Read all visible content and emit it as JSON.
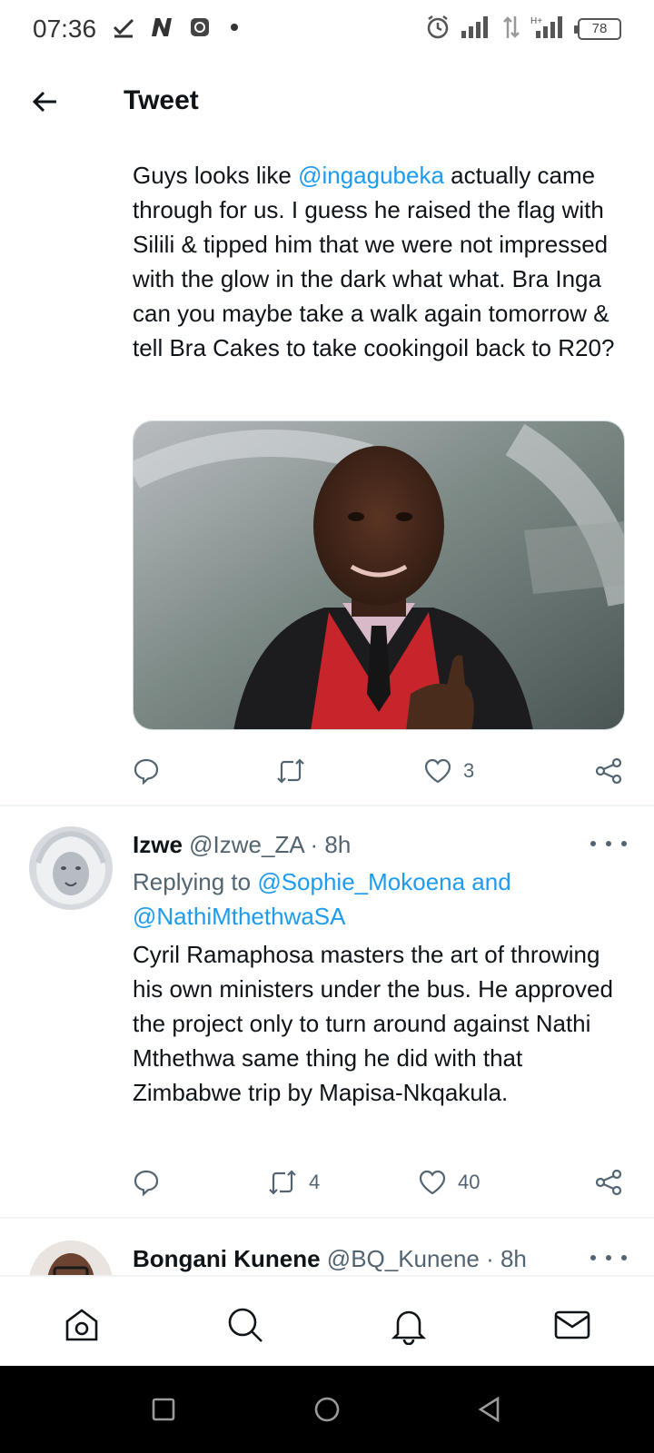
{
  "status_bar": {
    "time": "07:36",
    "battery": "78",
    "network_label": "H+"
  },
  "header": {
    "title": "Tweet"
  },
  "tweet1": {
    "text_before": "Guys looks like ",
    "mention": "@ingagubeka",
    "text_after": " actually came through for us. I guess he raised the flag with Silili & tipped him that we were not impressed with the glow in the dark what what. Bra Inga can you maybe take a walk again tomorrow & tell Bra Cakes to take cookingoil back to R20?",
    "retweets": "",
    "likes": "3"
  },
  "tweet2": {
    "name": "Izwe",
    "handle": "@Izwe_ZA",
    "time": "· 8h",
    "replying_label": "Replying to ",
    "replying_mention": "@Sophie_Mokoena and @NathiMthethwaSA",
    "text": "Cyril Ramaphosa masters the art of throwing his own ministers under the bus. He approved the project only to turn around against Nathi Mthethwa same thing he did with that Zimbabwe trip by Mapisa-Nkqakula.",
    "retweets": "4",
    "likes": "40"
  },
  "tweet3": {
    "name": "Bongani Kunene",
    "handle": "@BQ_Kunene",
    "time": "· 8h"
  },
  "colors": {
    "accent": "#1d9bf0",
    "text": "#0f1419",
    "secondary": "#536471",
    "divider": "#eff3f4"
  }
}
